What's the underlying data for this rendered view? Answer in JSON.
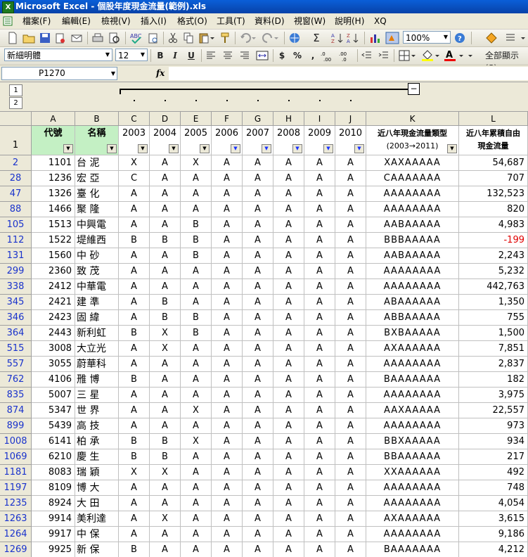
{
  "window": {
    "title": "Microsoft Excel - 個股年度現金流量(範例).xls",
    "app_icon": "X"
  },
  "menu": [
    "檔案(F)",
    "編輯(E)",
    "檢視(V)",
    "插入(I)",
    "格式(O)",
    "工具(T)",
    "資料(D)",
    "視窗(W)",
    "說明(H)",
    "XQ"
  ],
  "toolbar": {
    "zoom": "100%",
    "font": "新細明體",
    "font_size": "12",
    "bold": "B",
    "italic": "I",
    "underline": "U",
    "currency": "$",
    "percent": "%",
    "comma": ",",
    "autosum": "Σ",
    "show_all": "全部顯示(S)"
  },
  "formula_bar": {
    "name_box": "P1270",
    "fx": "fx",
    "value": ""
  },
  "outline": {
    "levels": [
      "1",
      "2"
    ],
    "collapse": "−"
  },
  "columns": [
    "A",
    "B",
    "C",
    "D",
    "E",
    "F",
    "G",
    "H",
    "I",
    "J",
    "K",
    "L"
  ],
  "header_row": {
    "row_number": "1",
    "cells": [
      "代號",
      "名稱",
      "2003",
      "2004",
      "2005",
      "2006",
      "2007",
      "2008",
      "2009",
      "2010",
      "近八年現金流量類型",
      "近八年累積自由"
    ],
    "k_line2": "(2003→2011)",
    "l_line2": "現金流量"
  },
  "rows": [
    {
      "n": "2",
      "code": "1101",
      "name": "台 泥",
      "y": [
        "X",
        "A",
        "X",
        "A",
        "A",
        "A",
        "A",
        "A"
      ],
      "type": "XAXAAAAA",
      "total": "54,687"
    },
    {
      "n": "28",
      "code": "1236",
      "name": "宏 亞",
      "y": [
        "C",
        "A",
        "A",
        "A",
        "A",
        "A",
        "A",
        "A"
      ],
      "type": "CAAAAAAA",
      "total": "707"
    },
    {
      "n": "47",
      "code": "1326",
      "name": "臺 化",
      "y": [
        "A",
        "A",
        "A",
        "A",
        "A",
        "A",
        "A",
        "A"
      ],
      "type": "AAAAAAAA",
      "total": "132,523"
    },
    {
      "n": "88",
      "code": "1466",
      "name": "聚 隆",
      "y": [
        "A",
        "A",
        "A",
        "A",
        "A",
        "A",
        "A",
        "A"
      ],
      "type": "AAAAAAAA",
      "total": "820"
    },
    {
      "n": "105",
      "code": "1513",
      "name": "中興電",
      "y": [
        "A",
        "A",
        "B",
        "A",
        "A",
        "A",
        "A",
        "A"
      ],
      "type": "AABAAAAA",
      "total": "4,983"
    },
    {
      "n": "112",
      "code": "1522",
      "name": "堤維西",
      "y": [
        "B",
        "B",
        "B",
        "A",
        "A",
        "A",
        "A",
        "A"
      ],
      "type": "BBBAAAAA",
      "total": "-199"
    },
    {
      "n": "131",
      "code": "1560",
      "name": "中 砂",
      "y": [
        "A",
        "A",
        "B",
        "A",
        "A",
        "A",
        "A",
        "A"
      ],
      "type": "AABAAAAA",
      "total": "2,243"
    },
    {
      "n": "299",
      "code": "2360",
      "name": "致 茂",
      "y": [
        "A",
        "A",
        "A",
        "A",
        "A",
        "A",
        "A",
        "A"
      ],
      "type": "AAAAAAAA",
      "total": "5,232"
    },
    {
      "n": "338",
      "code": "2412",
      "name": "中華電",
      "y": [
        "A",
        "A",
        "A",
        "A",
        "A",
        "A",
        "A",
        "A"
      ],
      "type": "AAAAAAAA",
      "total": "442,763"
    },
    {
      "n": "345",
      "code": "2421",
      "name": "建 準",
      "y": [
        "A",
        "B",
        "A",
        "A",
        "A",
        "A",
        "A",
        "A"
      ],
      "type": "ABAAAAAA",
      "total": "1,350"
    },
    {
      "n": "346",
      "code": "2423",
      "name": "固 緯",
      "y": [
        "A",
        "B",
        "B",
        "A",
        "A",
        "A",
        "A",
        "A"
      ],
      "type": "ABBAAAAA",
      "total": "755"
    },
    {
      "n": "364",
      "code": "2443",
      "name": "新利虹",
      "y": [
        "B",
        "X",
        "B",
        "A",
        "A",
        "A",
        "A",
        "A"
      ],
      "type": "BXBAAAAA",
      "total": "1,500"
    },
    {
      "n": "515",
      "code": "3008",
      "name": "大立光",
      "y": [
        "A",
        "X",
        "A",
        "A",
        "A",
        "A",
        "A",
        "A"
      ],
      "type": "AXAAAAAA",
      "total": "7,851"
    },
    {
      "n": "557",
      "code": "3055",
      "name": "蔚華科",
      "y": [
        "A",
        "A",
        "A",
        "A",
        "A",
        "A",
        "A",
        "A"
      ],
      "type": "AAAAAAAA",
      "total": "2,837"
    },
    {
      "n": "762",
      "code": "4106",
      "name": "雃 博",
      "y": [
        "B",
        "A",
        "A",
        "A",
        "A",
        "A",
        "A",
        "A"
      ],
      "type": "BAAAAAAA",
      "total": "182"
    },
    {
      "n": "835",
      "code": "5007",
      "name": "三 星",
      "y": [
        "A",
        "A",
        "A",
        "A",
        "A",
        "A",
        "A",
        "A"
      ],
      "type": "AAAAAAAA",
      "total": "3,975"
    },
    {
      "n": "874",
      "code": "5347",
      "name": "世 界",
      "y": [
        "A",
        "A",
        "X",
        "A",
        "A",
        "A",
        "A",
        "A"
      ],
      "type": "AAXAAAAA",
      "total": "22,557"
    },
    {
      "n": "899",
      "code": "5439",
      "name": "高 技",
      "y": [
        "A",
        "A",
        "A",
        "A",
        "A",
        "A",
        "A",
        "A"
      ],
      "type": "AAAAAAAA",
      "total": "973"
    },
    {
      "n": "1008",
      "code": "6141",
      "name": "柏 承",
      "y": [
        "B",
        "B",
        "X",
        "A",
        "A",
        "A",
        "A",
        "A"
      ],
      "type": "BBXAAAAA",
      "total": "934"
    },
    {
      "n": "1069",
      "code": "6210",
      "name": "慶 生",
      "y": [
        "B",
        "B",
        "A",
        "A",
        "A",
        "A",
        "A",
        "A"
      ],
      "type": "BBAAAAAA",
      "total": "217"
    },
    {
      "n": "1181",
      "code": "8083",
      "name": "瑞 穎",
      "y": [
        "X",
        "X",
        "A",
        "A",
        "A",
        "A",
        "A",
        "A"
      ],
      "type": "XXAAAAAA",
      "total": "492"
    },
    {
      "n": "1197",
      "code": "8109",
      "name": "博 大",
      "y": [
        "A",
        "A",
        "A",
        "A",
        "A",
        "A",
        "A",
        "A"
      ],
      "type": "AAAAAAAA",
      "total": "748"
    },
    {
      "n": "1235",
      "code": "8924",
      "name": "大 田",
      "y": [
        "A",
        "A",
        "A",
        "A",
        "A",
        "A",
        "A",
        "A"
      ],
      "type": "AAAAAAAA",
      "total": "4,054"
    },
    {
      "n": "1263",
      "code": "9914",
      "name": "美利達",
      "y": [
        "A",
        "X",
        "A",
        "A",
        "A",
        "A",
        "A",
        "A"
      ],
      "type": "AXAAAAAA",
      "total": "3,615"
    },
    {
      "n": "1264",
      "code": "9917",
      "name": "中 保",
      "y": [
        "A",
        "A",
        "A",
        "A",
        "A",
        "A",
        "A",
        "A"
      ],
      "type": "AAAAAAAA",
      "total": "9,186"
    },
    {
      "n": "1269",
      "code": "9925",
      "name": "新 保",
      "y": [
        "B",
        "A",
        "A",
        "A",
        "A",
        "A",
        "A",
        "A"
      ],
      "type": "BAAAAAAA",
      "total": "4,212"
    }
  ],
  "colors": {
    "header_green": "#c4f0c4",
    "negative": "#e00000",
    "row_link": "#1a33cc",
    "title_blue": "#0a5fd8"
  }
}
